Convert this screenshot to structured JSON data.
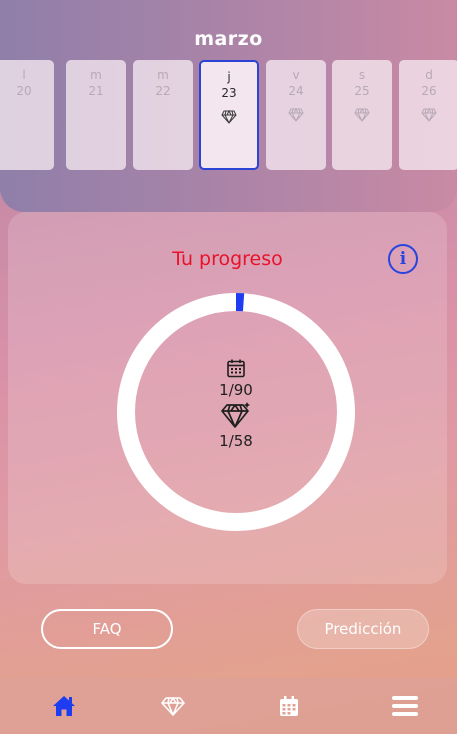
{
  "header": {
    "month": "marzo"
  },
  "days": [
    {
      "letter": "l",
      "number": "20",
      "has_gem": false,
      "selected": false
    },
    {
      "letter": "m",
      "number": "21",
      "has_gem": false,
      "selected": false
    },
    {
      "letter": "m",
      "number": "22",
      "has_gem": false,
      "selected": false
    },
    {
      "letter": "j",
      "number": "23",
      "has_gem": true,
      "selected": true
    },
    {
      "letter": "v",
      "number": "24",
      "has_gem": true,
      "selected": false
    },
    {
      "letter": "s",
      "number": "25",
      "has_gem": true,
      "selected": false
    },
    {
      "letter": "d",
      "number": "26",
      "has_gem": true,
      "selected": false
    }
  ],
  "progress": {
    "title": "Tu progreso",
    "info_icon": "info-icon",
    "days_value": "1/90",
    "gems_value": "1/58",
    "ring_fraction": 0.011,
    "ring_color": "#1f3df0",
    "ring_track_color": "#ffffff",
    "title_color": "#e8122a"
  },
  "buttons": {
    "faq_label": "FAQ",
    "prediction_label": "Predicción"
  },
  "tabbar": {
    "items": [
      {
        "icon": "home-icon",
        "active": true
      },
      {
        "icon": "gem-icon",
        "active": false
      },
      {
        "icon": "calendar-icon",
        "active": false
      },
      {
        "icon": "menu-icon",
        "active": false
      }
    ],
    "active_color": "#1f3df0"
  }
}
